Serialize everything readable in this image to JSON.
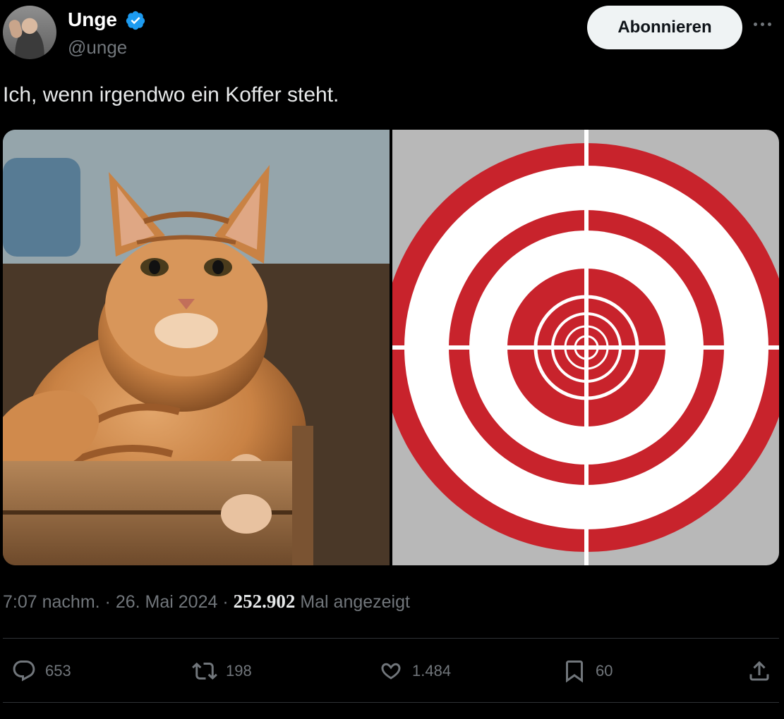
{
  "author": {
    "name": "Unge",
    "handle": "@unge",
    "verified_color": "#1d9bf0"
  },
  "follow_label": "Abonnieren",
  "tweet_text": "Ich, wenn irgendwo ein Koffer steht.",
  "media": {
    "left_image": "orange-cat-in-wooden-crate",
    "right_image": "red-white-target-crosshair",
    "target_red": "#c8232c"
  },
  "meta": {
    "time": "7:07 nachm.",
    "separator": "·",
    "date": "26. Mai 2024",
    "views": "252.902",
    "views_label": "Mal angezeigt"
  },
  "actions": {
    "replies": "653",
    "reposts": "198",
    "likes": "1.484",
    "bookmarks": "60"
  },
  "icons": [
    "reply-icon",
    "repost-icon",
    "like-icon",
    "bookmark-icon",
    "share-icon",
    "more-icon",
    "verified-badge-icon"
  ]
}
